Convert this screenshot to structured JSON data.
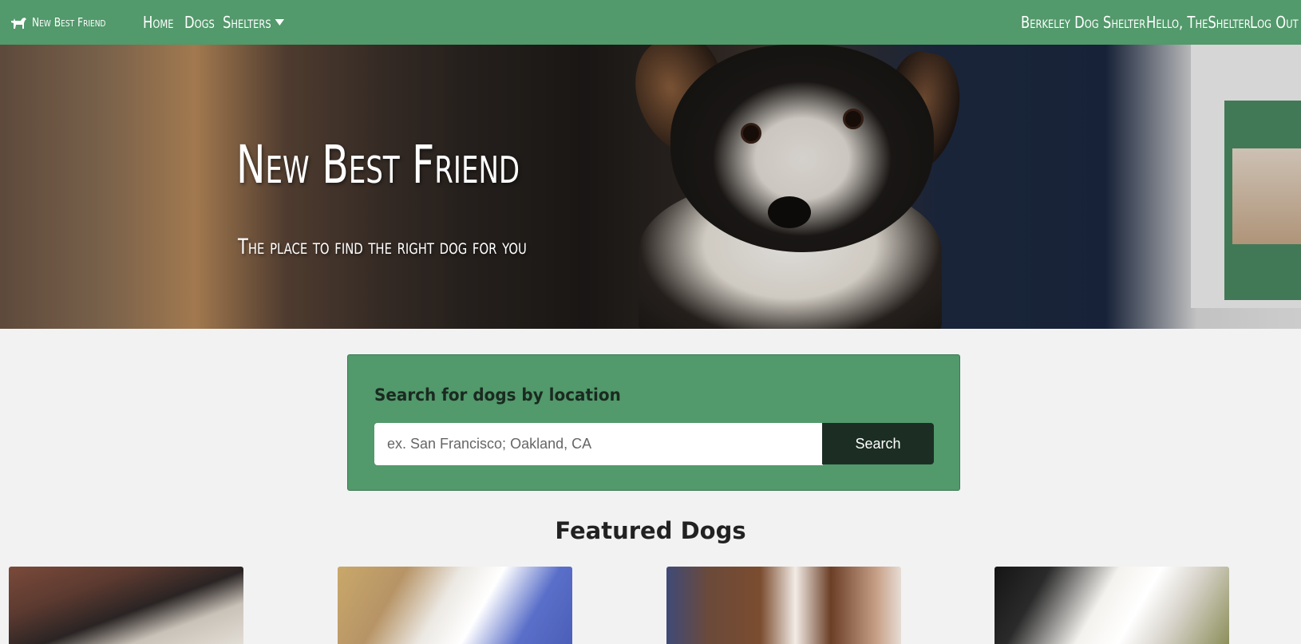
{
  "nav": {
    "brand": "New Best Friend",
    "links": [
      "Home",
      "Dogs",
      "Shelters"
    ],
    "shelter_name": "Berkeley Dog Shelter",
    "greeting": "Hello, TheShelter",
    "logout": "Log Out",
    "brand_icon": "dog-icon"
  },
  "hero": {
    "title": "New Best Friend",
    "subtitle": "The place to find the right dog for you"
  },
  "search": {
    "heading": "Search for dogs by location",
    "placeholder": "ex. San Francisco; Oakland, CA",
    "button_label": "Search"
  },
  "featured": {
    "heading": "Featured Dogs"
  },
  "colors": {
    "primary": "#52996b",
    "dark_button": "#1c2e24",
    "background": "#f2f2f2"
  }
}
